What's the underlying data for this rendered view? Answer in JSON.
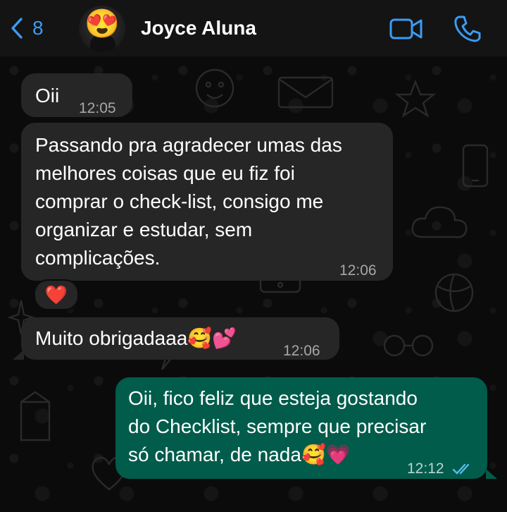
{
  "header": {
    "back_count": "8",
    "contact_name": "Joyce Aluna",
    "avatar_emoji": "😍"
  },
  "messages": [
    {
      "direction": "in",
      "text": "Oii",
      "time": "12:05"
    },
    {
      "direction": "in",
      "text": "Passando pra agradecer umas das\nmelhores coisas que eu fiz foi\ncomprar o check-list, consigo me\norganizar e estudar, sem\ncomplicações.",
      "time": "12:06",
      "reaction": "❤️"
    },
    {
      "direction": "in",
      "text": "Muito obrigadaaa🥰💕",
      "time": "12:06"
    },
    {
      "direction": "out",
      "text": "Oii, fico feliz que esteja gostando\ndo Checklist, sempre que precisar\nsó chamar, de nada🥰💗",
      "time": "12:12",
      "status": "read"
    }
  ],
  "colors": {
    "accent": "#3b9cf5",
    "incoming_bubble": "#262626",
    "outgoing_bubble": "#015c4b",
    "background": "#0b0b0b"
  },
  "icons": {
    "back": "chevron-left-icon",
    "video": "video-camera-icon",
    "call": "phone-icon",
    "read_receipt": "double-check-icon"
  }
}
